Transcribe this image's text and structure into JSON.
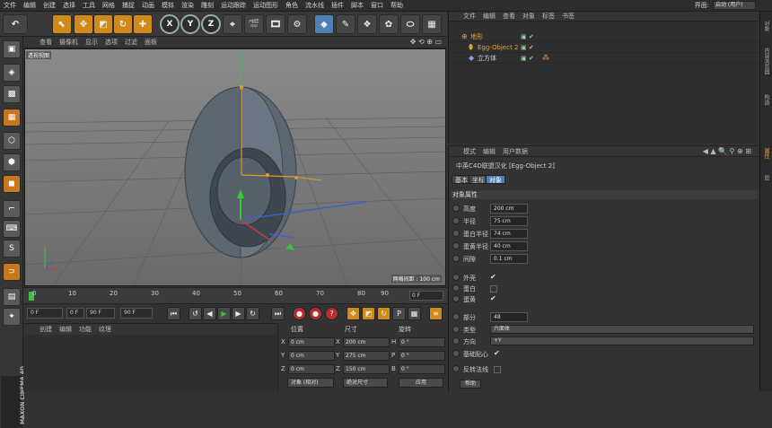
{
  "menubar": {
    "items": [
      "文件",
      "编辑",
      "创建",
      "选择",
      "工具",
      "网格",
      "捕捉",
      "动画",
      "模拟",
      "渲染",
      "雕刻",
      "运动跟踪",
      "运动图形",
      "角色",
      "流水线",
      "插件",
      "脚本",
      "窗口",
      "帮助"
    ],
    "layout_label": "界面:",
    "layout_value": "启动 (用户)"
  },
  "toolbar": {
    "undo_icon": "undo-icon",
    "axis_x": "X",
    "axis_y": "Y",
    "axis_z": "Z"
  },
  "viewport": {
    "menu": [
      "查看",
      "摄像机",
      "显示",
      "选项",
      "过滤",
      "面板"
    ],
    "label": "透视视图",
    "grid_spacing": "网格间距 : 100 cm"
  },
  "timeline": {
    "ticks": [
      "0",
      "10",
      "20",
      "30",
      "40",
      "50",
      "60",
      "70",
      "80",
      "90"
    ],
    "frame_end_label": "0 F"
  },
  "transport": {
    "current_frame": "0 F",
    "start_frame": "0 F",
    "min_frame": "90 F",
    "end_frame": "90 F"
  },
  "materials": {
    "menu": [
      "创建",
      "编辑",
      "功能",
      "纹理"
    ]
  },
  "coords": {
    "headers": [
      "位置",
      "尺寸",
      "旋转"
    ],
    "rows": [
      {
        "axis": "X",
        "pos": "0 cm",
        "size_axis": "X",
        "size": "200 cm",
        "rot_axis": "H",
        "rot": "0 °"
      },
      {
        "axis": "Y",
        "pos": "0 cm",
        "size_axis": "Y",
        "size": "275 cm",
        "rot_axis": "P",
        "rot": "0 °"
      },
      {
        "axis": "Z",
        "pos": "0 cm",
        "size_axis": "Z",
        "size": "150 cm",
        "rot_axis": "B",
        "rot": "0 °"
      }
    ],
    "mode": "对象 (相对)",
    "size_mode": "绝对尺寸",
    "apply": "应用"
  },
  "objects": {
    "menu": [
      "文件",
      "编辑",
      "查看",
      "对象",
      "标签",
      "书签"
    ],
    "list": [
      {
        "name": "地形",
        "color": "#e5a33a"
      },
      {
        "name": "Egg-Object 2",
        "color": "#e5a33a"
      },
      {
        "name": "立方体",
        "color": "#d0d0d0"
      }
    ]
  },
  "attributes": {
    "menu": [
      "模式",
      "编辑",
      "用户数据"
    ],
    "title": "中英C4D联盟汉化 [Egg-Object 2]",
    "tabs": [
      "基本",
      "坐标",
      "对象"
    ],
    "active_tab": "对象",
    "section": "对象属性",
    "params": [
      {
        "label": "高度",
        "value": "200 cm"
      },
      {
        "label": "半径",
        "value": "75 cm"
      },
      {
        "label": "蛋白半径",
        "value": "74 cm"
      },
      {
        "label": "蛋黄半径",
        "value": "40 cm"
      },
      {
        "label": "间隙",
        "value": "0.1 cm"
      }
    ],
    "checks": [
      {
        "label": "外壳",
        "checked": "✔"
      },
      {
        "label": "蛋白",
        "checked": ""
      },
      {
        "label": "蛋黄",
        "checked": "✔"
      }
    ],
    "segments_label": "部分",
    "segments_value": "48",
    "type_label": "类型",
    "type_value": "六面体",
    "dir_label": "方向",
    "dir_value": "+Y",
    "phong_label": "基础贴心",
    "phong_check": "✔",
    "reverse_label": "反转法线",
    "help_btn": "帮助"
  },
  "right_tabs": [
    "对象",
    "内容浏览器",
    "构造",
    "属性",
    "层"
  ],
  "colors": {
    "accent": "#d08a1a",
    "selected": "#4f7fb5"
  }
}
